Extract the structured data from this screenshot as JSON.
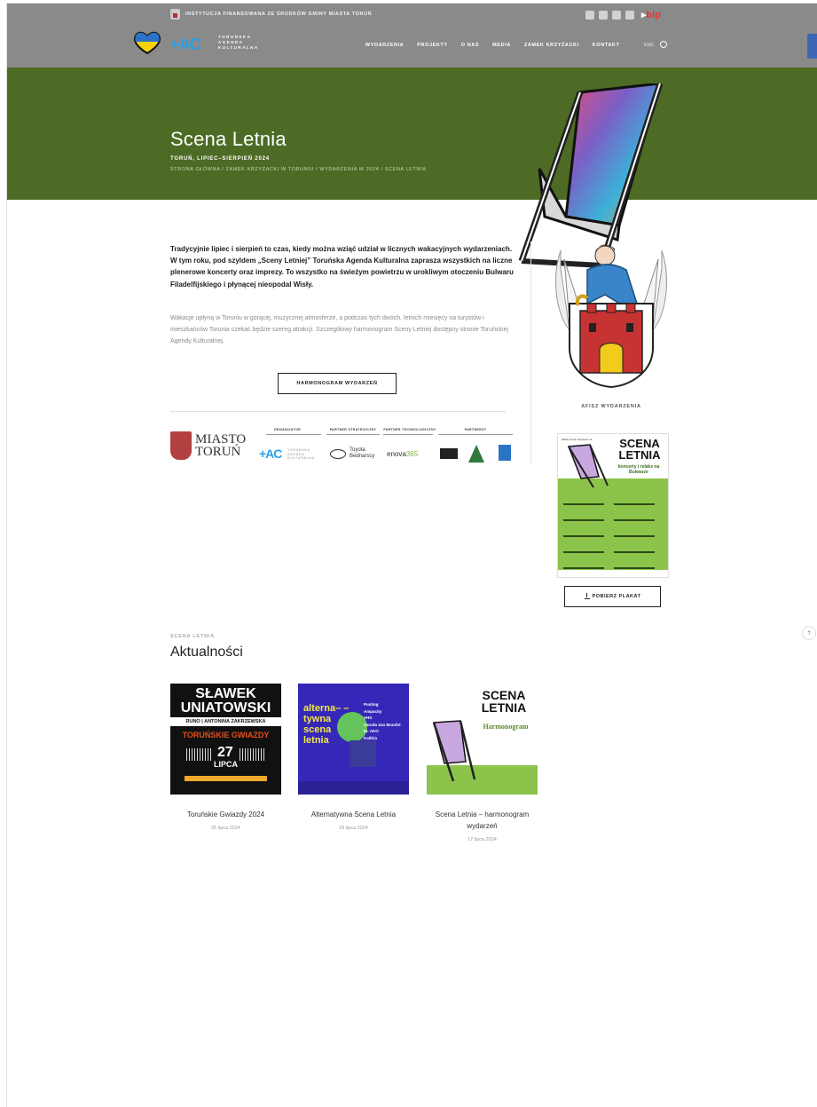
{
  "header": {
    "funding_text": "INSTYTUCJA FINANSOWANA ZE ŚRODKÓW GMINY MIASTA TORUŃ",
    "bip": "bip",
    "logo_words": [
      "TORUŃSKA",
      "AGENDA",
      "KULTURALNA"
    ],
    "logo_mark": "+AC",
    "nav": [
      "WYDARZENIA",
      "PROJEKTY",
      "O NAS",
      "MEDIA",
      "ZAMEK KRZYŻACKI",
      "KONTAKT"
    ],
    "lang": "ENG"
  },
  "hero": {
    "title": "Scena Letnia",
    "subtitle": "TORUŃ, LIPIEC–SIERPIEŃ 2024",
    "breadcrumbs": "STRONA GŁÓWNA / ZAMEK KRZYŻACKI W TORUNIU / WYDARZENIA W 2024 / SCENA LETNIA",
    "bg_color": "#4d6b24"
  },
  "intro": {
    "bold": "Tradycyjnie lipiec i sierpień to czas, kiedy można wziąć udział w licznych wakacyjnych wydarzeniach. W tym roku, pod szyldem „Sceny Letniej” Toruńska Agenda Kulturalna zaprasza wszystkich na liczne plenerowe koncerty oraz imprezy. To wszystko na świeżym powietrzu w urokliwym otoczeniu Bulwaru Filadelfijskiego i płynącej nieopodal Wisły.",
    "text": "Wakacje upłyną w Toruniu w gorącej, muzycznej atmosferze, a podczas tych dwóch, letnich miesięcy na turystów i mieszkańców Torunia czekać będzie szereg atrakcji. Szczegółowy harmonogram Sceny Letniej dostępny stronie Toruńskiej Agendy Kulturalnej.",
    "button": "HARMONOGRAM WYDARZEŃ"
  },
  "sponsors": {
    "miasto": "MIASTO",
    "torun": "TORUŃ",
    "labels": [
      "ORGANIZATOR",
      "PARTNER STRATEGICZNY",
      "PARTNER TECHNOLOGICZNY",
      "PARTNERZY"
    ],
    "tak": "+AC",
    "toyota": "Toyota Bednarscy",
    "enova_a": "enova",
    "enova_b": "365"
  },
  "sidebar": {
    "afisz_label": "AFISZ WYDARZENIA",
    "poster_header": "Miasto Toruń zaprasza na",
    "poster_title": "SCENA LETNIA",
    "poster_sub": "koncerty i relaks na Bulwarze",
    "download_button": "POBIERZ PLAKAT"
  },
  "news": {
    "kicker": "SCENA LETNIA",
    "heading": "Aktualności",
    "items": [
      {
        "title": "Toruńskie Gwiazdy 2024",
        "date": "26 lipca 2024"
      },
      {
        "title": "Alternatywna Scena Letnia",
        "date": "18 lipca 2024"
      },
      {
        "title": "Scena Letnia – harmonogram wydarzeń",
        "date": "17 lipca 2024"
      }
    ],
    "card1": {
      "line1": "SŁAWEK",
      "line2": "UNIATOWSKI",
      "names": "RUNO | ANTONINA ZAKRZEWSKA",
      "series": "TORUŃSKIE GWIAZDY",
      "day": "27",
      "month": "LIPCA"
    },
    "card2": {
      "title": "alterna– –tywna scena letnia",
      "list": [
        "Pusting",
        "Ampacity",
        "VHS",
        "Zaruda Zan Brunfol",
        "EL AKO",
        "Kalthia"
      ]
    },
    "card3": {
      "title": "SCENA LETNIA",
      "sub": "Harmonogram"
    }
  },
  "colors": {
    "accent_blue": "#29a0e6",
    "hero_green": "#4d6b24",
    "poster_green": "#8cc34a"
  }
}
